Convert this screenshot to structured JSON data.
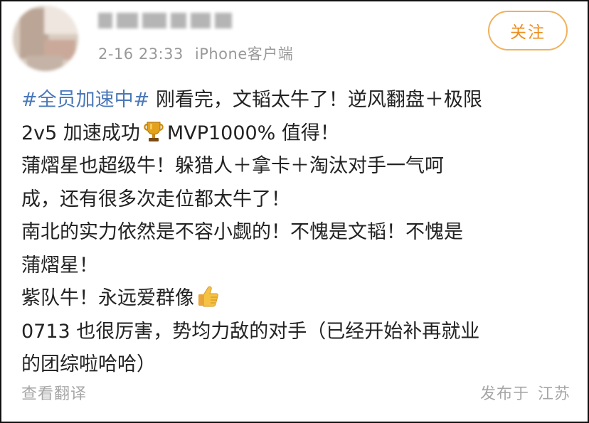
{
  "post": {
    "username": "",
    "time": "2-16 23:33",
    "source": "iPhone客户端",
    "follow_label": "关注",
    "content": {
      "hashtag": "#全员加速中#",
      "line1_text": " 刚看完，文韬太牛了！逆风翻盘＋极限",
      "line2_a": "2v5 加速成功",
      "line2_emoji": "trophy-icon",
      "line2_b": "MVP1000% 值得！",
      "line3": "蒲熠星也超级牛！躲猎人＋拿卡＋淘汰对手一气呵",
      "line4": "成，还有很多次走位都太牛了！",
      "line5": "南北的实力依然是不容小觑的！不愧是文韬！不愧是",
      "line6": "蒲熠星！",
      "line7_a": "紫队牛！永远爱群像",
      "line7_emoji": "thumbs-up-icon",
      "line8": "0713 也很厉害，势均力敌的对手（已经开始补再就业",
      "line9": "的团综啦哈哈）"
    },
    "translate_label": "查看翻译",
    "location_prefix": "发布于",
    "location": "江苏"
  },
  "colors": {
    "hashtag": "#4a78b8",
    "follow": "#ee8e1f",
    "meta": "#999999"
  }
}
